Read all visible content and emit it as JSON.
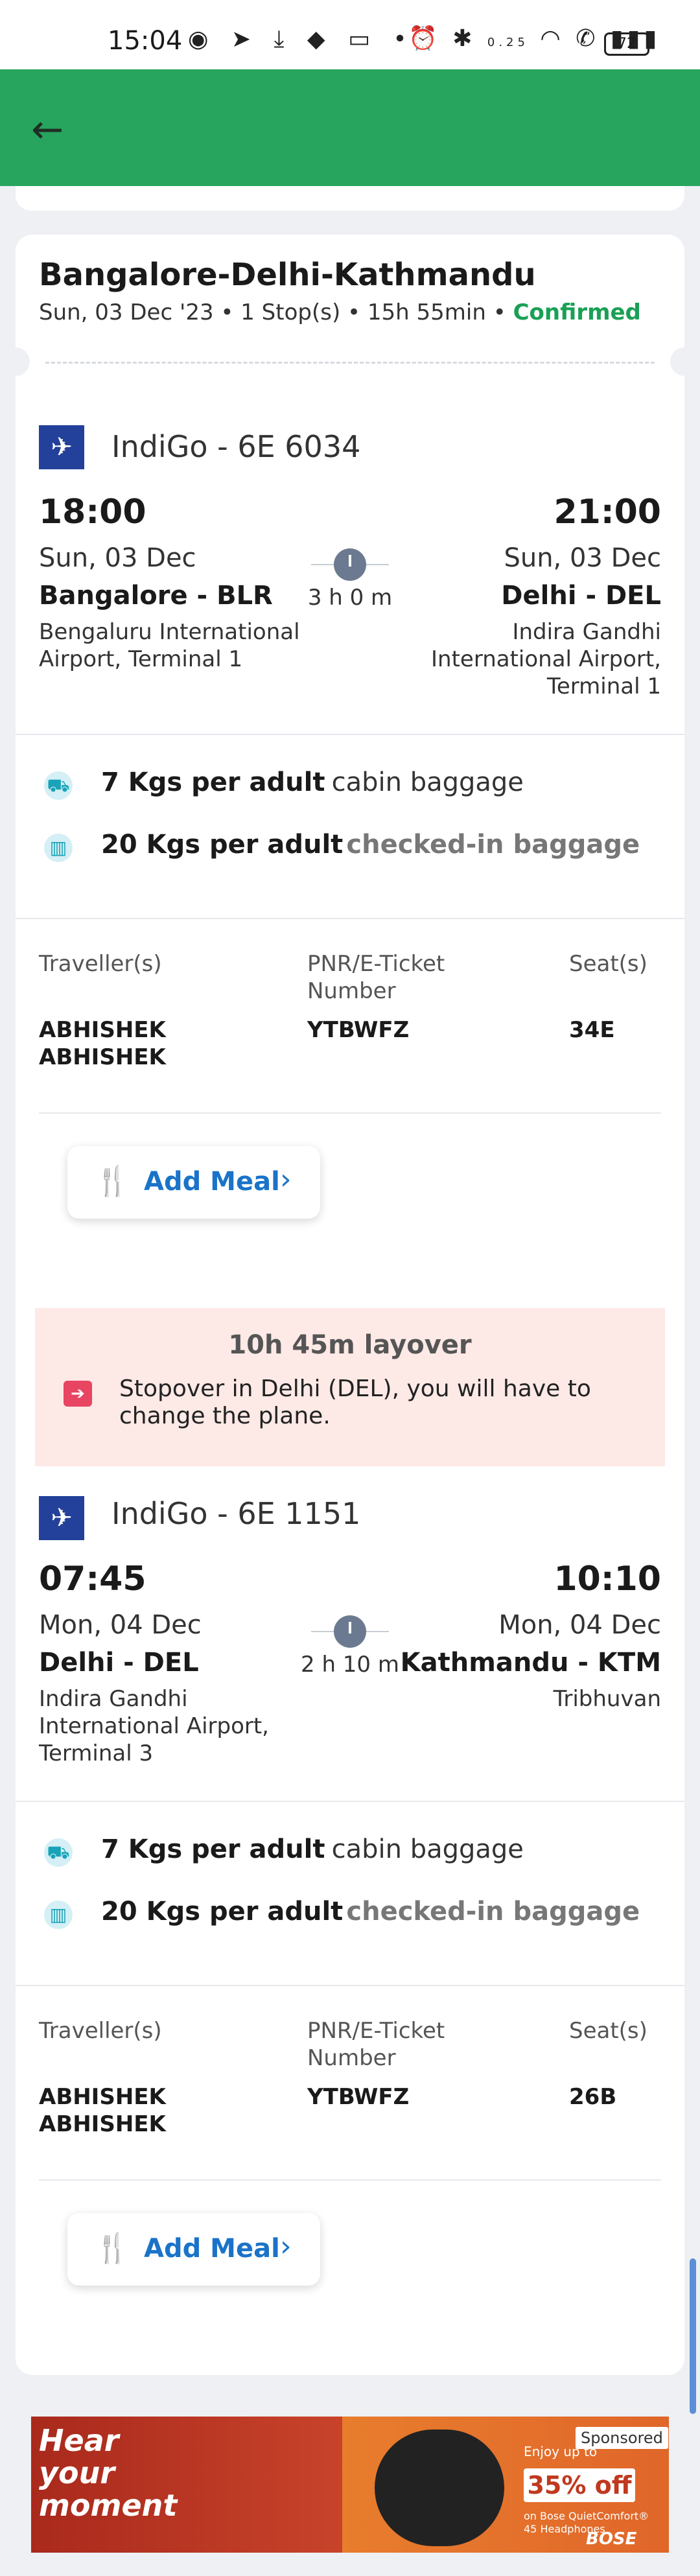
{
  "status_bar": {
    "time": "15:04",
    "net_speed": "0.25",
    "net_unit": "KB/S",
    "battery": "72"
  },
  "trip": {
    "route": "Bangalore-Delhi-Kathmandu",
    "summary": "Sun, 03 Dec '23 • 1 Stop(s) • 15h 55min • ",
    "status": "Confirmed"
  },
  "segments": [
    {
      "airline": "IndiGo - 6E 6034",
      "dep_time": "18:00",
      "dep_date": "Sun, 03 Dec",
      "dep_city": "Bangalore - BLR",
      "dep_airport": "Bengaluru International Airport, Terminal 1",
      "duration": "3 h 0 m",
      "arr_time": "21:00",
      "arr_date": "Sun, 03 Dec",
      "arr_city": "Delhi - DEL",
      "arr_airport": "Indira Gandhi International Airport, Terminal 1",
      "cabin_bold": "7 Kgs per adult",
      "cabin_text": "cabin baggage",
      "checkin_bold": "20 Kgs per adult",
      "checkin_text": "checked-in baggage",
      "hdr_traveller": "Traveller(s)",
      "hdr_pnr": "PNR/E-Ticket Number",
      "hdr_seat": "Seat(s)",
      "traveller": "ABHISHEK ABHISHEK",
      "pnr": "YTBWFZ",
      "seat": "34E",
      "meal": "Add Meal"
    },
    {
      "airline": "IndiGo - 6E 1151",
      "dep_time": "07:45",
      "dep_date": "Mon, 04 Dec",
      "dep_city": "Delhi - DEL",
      "dep_airport": "Indira Gandhi International Airport, Terminal 3",
      "duration": "2 h 10 m",
      "arr_time": "10:10",
      "arr_date": "Mon, 04 Dec",
      "arr_city": "Kathmandu - KTM",
      "arr_airport": "Tribhuvan",
      "cabin_bold": "7 Kgs per adult",
      "cabin_text": "cabin baggage",
      "checkin_bold": "20 Kgs per adult",
      "checkin_text": "checked-in baggage",
      "hdr_traveller": "Traveller(s)",
      "hdr_pnr": "PNR/E-Ticket Number",
      "hdr_seat": "Seat(s)",
      "traveller": "ABHISHEK ABHISHEK",
      "pnr": "YTBWFZ",
      "seat": "26B",
      "meal": "Add Meal"
    }
  ],
  "layover": {
    "title": "10h 45m layover",
    "message": "Stopover in Delhi (DEL), you will have to change the plane."
  },
  "ad": {
    "headline": "Hear your moment",
    "enjoy": "Enjoy up to",
    "offer": "35% off",
    "detail": "on Bose QuietComfort® 45 Headphones",
    "brand": "BOSE",
    "sponsored": "Sponsored"
  },
  "colors": {
    "appbar": "#27a55e",
    "confirmed": "#1aa056",
    "link": "#1a73c8",
    "logo": "#23419a",
    "layover_bg": "#fde9e6"
  }
}
